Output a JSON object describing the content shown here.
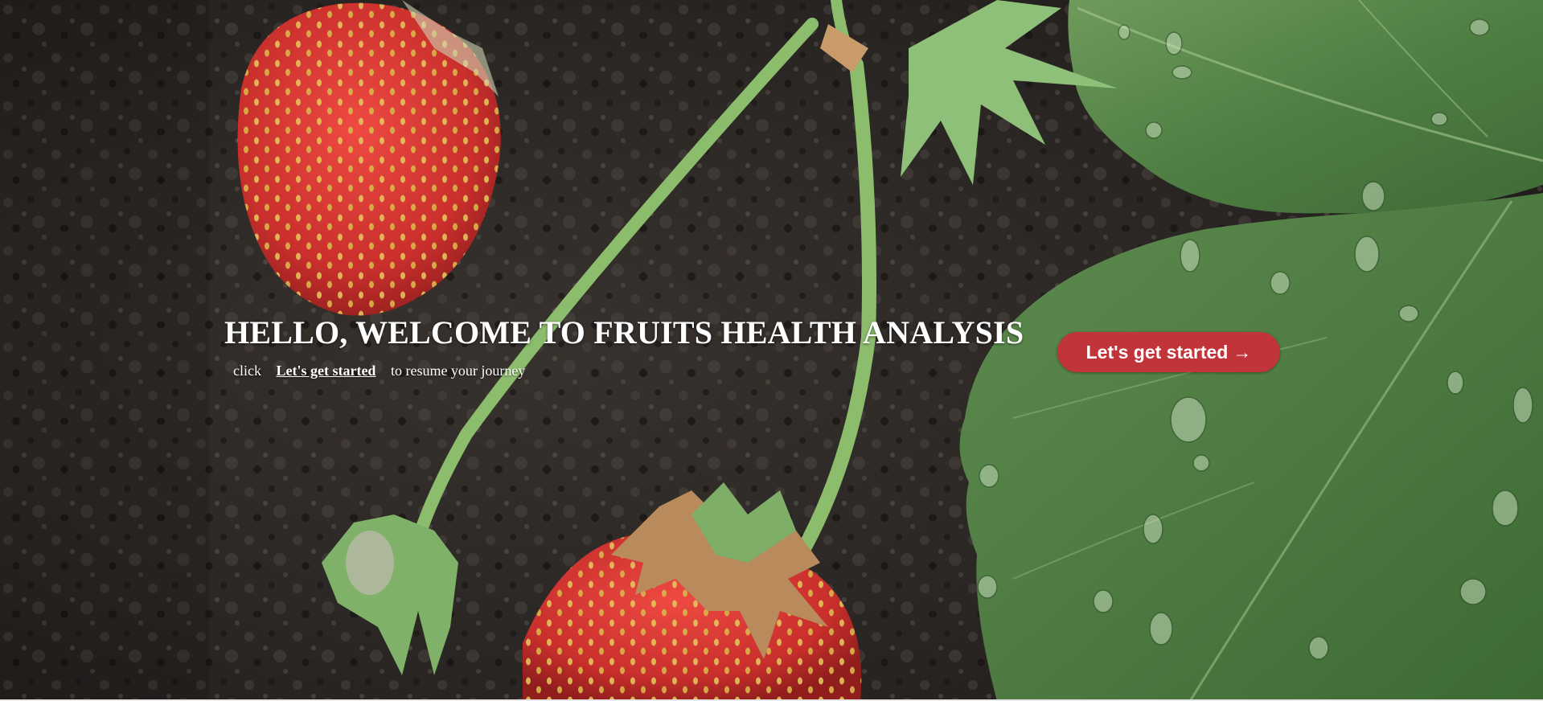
{
  "hero": {
    "title": "HELLO, WELCOME TO FRUITS HEALTH ANALYSIS",
    "subtitle_prefix": "click",
    "subtitle_link": "Let's get started",
    "subtitle_suffix": "to resume your journey",
    "background_image": "strawberry-plant-with-leaves-on-soil"
  },
  "cta": {
    "label": "Let's get started",
    "icon": "→"
  },
  "colors": {
    "cta_background": "#c0343a",
    "text": "#ffffff",
    "soil": "#2a2623",
    "leaf": "#4a7a3f",
    "strawberry": "#d23a35"
  }
}
